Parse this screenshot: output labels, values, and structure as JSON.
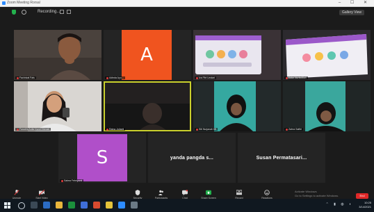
{
  "window": {
    "title": "Zoom Meeting Rorsal"
  },
  "topbar": {
    "recording_label": "Recording...",
    "view_label": "Gallery View"
  },
  "tiles": [
    {
      "name": "Fachrizal Fals"
    },
    {
      "name": "Adinda Ayu...",
      "initial": "A"
    },
    {
      "name": "Iza Fitri Lestari"
    },
    {
      "name": "Keke Nurfadillah"
    },
    {
      "name": "Faradila Aulia Nurul Hikmah"
    },
    {
      "name": "Ratna Julianti"
    },
    {
      "name": "Siti Nurjanah 8B"
    },
    {
      "name": "Zahra Safitri"
    },
    {
      "name": "Salma Febriyanti",
      "initial": "S"
    },
    {
      "name": "yanda pangda s..."
    },
    {
      "name": "Susan Permatasari..."
    }
  ],
  "tile_labels": {
    "yanda": "yanda pangda s...",
    "susan": "Susan Permatasari..."
  },
  "toolbar": {
    "mute": "Unmute",
    "video": "Start Video",
    "security": "Security",
    "participants": "Participants",
    "chat": "Chat",
    "share": "Share Screen",
    "record": "Record",
    "reactions": "Reactions",
    "end": "End",
    "watermark_line1": "Activate Windows",
    "watermark_line2": "Go to Settings to activate Windows."
  },
  "taskbar": {
    "time": "10:25",
    "date": "3/14/2021"
  },
  "colors": {
    "tile_orange": "#f0541f",
    "tile_purple": "#b04fc9",
    "teal_wall": "#35a8a0",
    "active_border": "#c9d02c",
    "end_red": "#e02828"
  }
}
